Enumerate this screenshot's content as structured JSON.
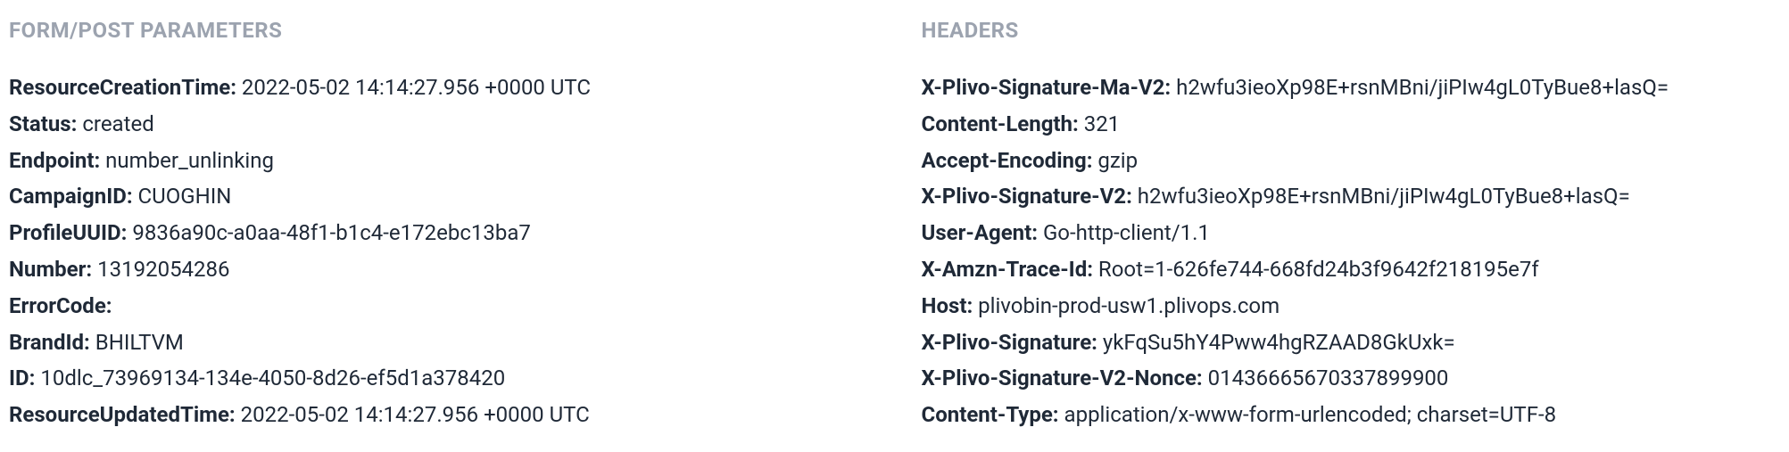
{
  "sections": {
    "formPost": {
      "title": "FORM/POST PARAMETERS",
      "items": [
        {
          "key": "ResourceCreationTime:",
          "value": " 2022-05-02 14:14:27.956 +0000 UTC"
        },
        {
          "key": "Status:",
          "value": " created"
        },
        {
          "key": "Endpoint:",
          "value": " number_unlinking"
        },
        {
          "key": "CampaignID:",
          "value": " CUOGHIN"
        },
        {
          "key": "ProfileUUID:",
          "value": " 9836a90c-a0aa-48f1-b1c4-e172ebc13ba7"
        },
        {
          "key": "Number:",
          "value": " 13192054286"
        },
        {
          "key": "ErrorCode:",
          "value": ""
        },
        {
          "key": "BrandId:",
          "value": " BHILTVM"
        },
        {
          "key": "ID:",
          "value": " 10dlc_73969134-134e-4050-8d26-ef5d1a378420"
        },
        {
          "key": "ResourceUpdatedTime:",
          "value": " 2022-05-02 14:14:27.956 +0000 UTC"
        }
      ]
    },
    "headers": {
      "title": "HEADERS",
      "items": [
        {
          "key": "X-Plivo-Signature-Ma-V2:",
          "value": " h2wfu3ieoXp98E+rsnMBni/jiPIw4gL0TyBue8+lasQ="
        },
        {
          "key": "Content-Length:",
          "value": " 321"
        },
        {
          "key": "Accept-Encoding:",
          "value": " gzip"
        },
        {
          "key": "X-Plivo-Signature-V2:",
          "value": " h2wfu3ieoXp98E+rsnMBni/jiPIw4gL0TyBue8+lasQ="
        },
        {
          "key": "User-Agent:",
          "value": " Go-http-client/1.1"
        },
        {
          "key": "X-Amzn-Trace-Id:",
          "value": " Root=1-626fe744-668fd24b3f9642f218195e7f"
        },
        {
          "key": "Host:",
          "value": " plivobin-prod-usw1.plivops.com"
        },
        {
          "key": "X-Plivo-Signature:",
          "value": " ykFqSu5hY4Pww4hgRZAAD8GkUxk="
        },
        {
          "key": "X-Plivo-Signature-V2-Nonce:",
          "value": " 01436665670337899900"
        },
        {
          "key": "Content-Type:",
          "value": " application/x-www-form-urlencoded; charset=UTF-8"
        }
      ]
    }
  }
}
